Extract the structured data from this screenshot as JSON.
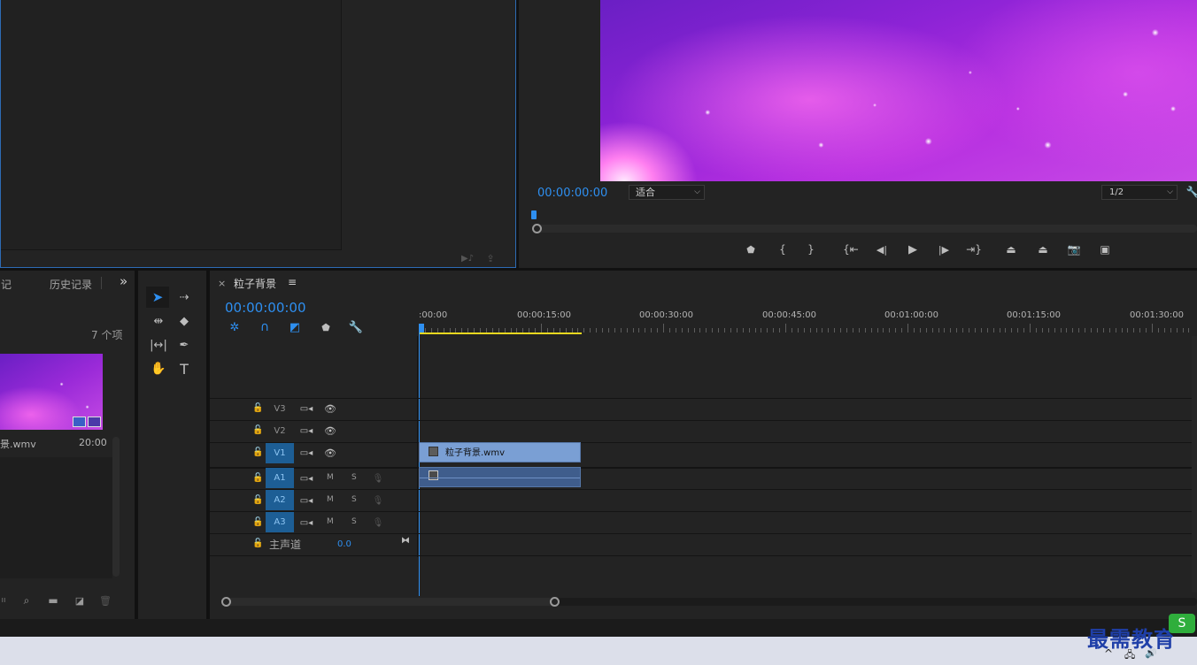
{
  "source_monitor": {},
  "program_monitor": {
    "timecode": "00:00:00:00",
    "fit_select": "适合",
    "resolution_select": "1/2",
    "transport": [
      "add-marker",
      "mark-in",
      "mark-out",
      "go-to-in",
      "step-back",
      "play",
      "step-forward",
      "go-to-out",
      "lift",
      "extract",
      "export-frame",
      "compare-view"
    ]
  },
  "project_panel": {
    "tab_partial": "记",
    "tab_history": "历史记录",
    "overflow": "»",
    "item_count": "7 个项",
    "clip": {
      "name": "景.wmv",
      "duration": "20:00"
    }
  },
  "tools": [
    "selection",
    "track-select-forward",
    "ripple-edit",
    "razor",
    "slip",
    "pen",
    "hand",
    "type"
  ],
  "timeline": {
    "close": "×",
    "sequence_name": "粒子背景",
    "menu": "≡",
    "timecode": "00:00:00:00",
    "ruler_labels": [
      ":00:00",
      "00:00:15:00",
      "00:00:30:00",
      "00:00:45:00",
      "00:01:00:00",
      "00:01:15:00",
      "00:01:30:00"
    ],
    "video_tracks": [
      "V3",
      "V2",
      "V1"
    ],
    "audio_tracks": [
      "A1",
      "A2",
      "A3"
    ],
    "audio_buttons": {
      "mute": "M",
      "solo": "S"
    },
    "master": {
      "label": "主声道",
      "value": "0.0"
    },
    "video_clip": "粒子背景.wmv"
  },
  "watermark": "最需教育",
  "colors": {
    "accent": "#2e8ff0",
    "clip_video": "#7a9fd4",
    "clip_audio": "#3f5d8c",
    "track_target": "#1d5e95",
    "work_area": "#e8d81f"
  }
}
